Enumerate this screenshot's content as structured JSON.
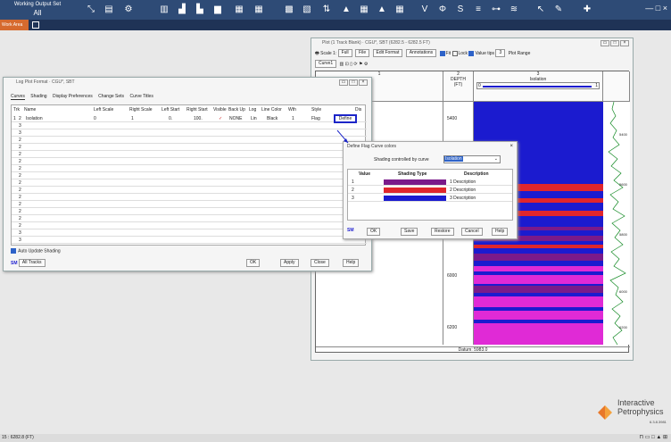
{
  "topbar": {
    "working_output_label": "Working Output Set",
    "working_output_value": "All",
    "window_controls": "—  □  ×"
  },
  "tabbar": {
    "work_area": "Work Area"
  },
  "status": {
    "depth_readout": "15 : 6282.8 (FT)",
    "icons": "⊓ ▭ □ ▲ ⊞"
  },
  "logo": {
    "line1": "Interactive",
    "line2": "Petrophysics",
    "version": "6.3.8.3981"
  },
  "plot": {
    "title": "Plot (1 Track Blank) · CGU*, SBT (6282.5 - 6282.5 FT)",
    "scale_label": "Scale 1:",
    "scale_value": "Full",
    "file_label": "File",
    "edit_format": "Edit Format",
    "annotations": "Annotations",
    "fit": "Fit",
    "lock": "Lock",
    "value_tips": "Value tips",
    "value_tips_n": "3",
    "plot_range": "Plot Range",
    "curve_select": "Curve1",
    "track1_num": "1",
    "track2_num": "2",
    "track3_num": "3",
    "depth_header": "DEPTH\n(FT)",
    "isolation_header": "Isolation",
    "iso_left": "0",
    "iso_right": "1",
    "depth_labels": [
      "5400",
      "5600",
      "5800",
      "6000",
      "6200"
    ],
    "gr_labels": [
      "5400",
      "5600",
      "5800",
      "6000",
      "6200"
    ],
    "datum": "Datum: 5983.0",
    "flag_colors": {
      "purple": "#7a1a8a",
      "red": "#e0262c",
      "blue": "#1b1bcf",
      "magenta": "#e02ad6"
    }
  },
  "format_dialog": {
    "title": "Log Plot Format · CGU*, SBT",
    "tabs": [
      "Curves",
      "Shading",
      "Display Preferences",
      "Change Sets",
      "Curve Titles"
    ],
    "headers": [
      "Trk",
      "Name",
      "Left Scale",
      "Right Scale",
      "Left Start",
      "Right Start",
      "Visible",
      "Back Up",
      "Log",
      "Line Color",
      "Wth",
      "Style",
      "Dis"
    ],
    "row1": {
      "trk": "1",
      "num": "2",
      "name": "Isolation",
      "left_scale": "0",
      "right_scale": "1",
      "left_start": "0.",
      "right_start": "100.",
      "visible": "✓",
      "backup": "NONE",
      "log": "Lin",
      "color": "Black",
      "wth": "1",
      "style": "Flag"
    },
    "row_nums": [
      "3",
      "3",
      "2",
      "2",
      "2",
      "2",
      "2",
      "2",
      "2",
      "2",
      "2",
      "2",
      "2",
      "2",
      "2",
      "3",
      "3"
    ],
    "define_btn": "Define",
    "auto_update": "Auto Update Shading",
    "sm": "SM",
    "all_tracks": "All Tracks",
    "ok": "OK",
    "apply": "Apply",
    "close": "Close",
    "help": "Help"
  },
  "flag_dialog": {
    "title": "Define Flag Curve colors",
    "shading_label": "Shading controlled by curve",
    "shading_value": "Isolation",
    "headers": [
      "Value",
      "Shading Type",
      "Description"
    ],
    "rows": [
      {
        "value": "1",
        "color": "#7a1a8a",
        "desc": "1 Description"
      },
      {
        "value": "2",
        "color": "#e0262c",
        "desc": "2 Description"
      },
      {
        "value": "3",
        "color": "#1b1bcf",
        "desc": "3 Description"
      }
    ],
    "sm": "SM",
    "ok": "OK",
    "save": "Save",
    "restore": "Restore",
    "cancel": "Cancel",
    "help": "Help"
  }
}
